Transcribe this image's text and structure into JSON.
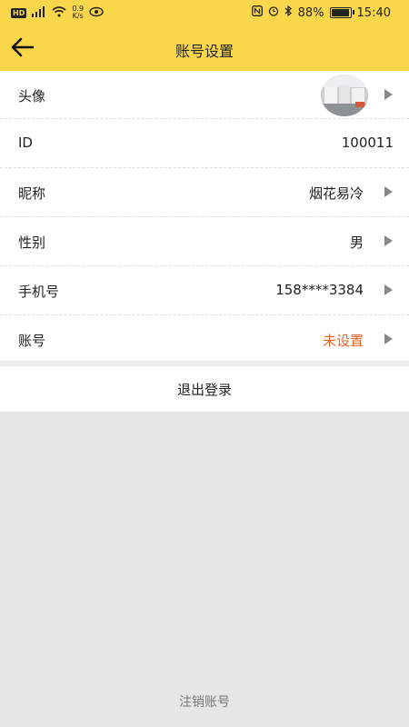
{
  "status_bar": {
    "network": "HD",
    "signal": "4G",
    "speed_value": "0.9",
    "speed_unit": "K/s",
    "battery": "88%",
    "battery_level": 0.88,
    "time": "15:40",
    "icons": [
      "nfc-icon",
      "alarm-icon",
      "bluetooth-icon",
      "eye-icon",
      "wifi-icon"
    ]
  },
  "header": {
    "title": "账号设置",
    "back_icon": "arrow-left-icon"
  },
  "rows": {
    "avatar": {
      "label": "头像"
    },
    "id": {
      "label": "ID",
      "value": "100011"
    },
    "nickname": {
      "label": "昵称",
      "value": "烟花易冷"
    },
    "gender": {
      "label": "性别",
      "value": "男"
    },
    "phone": {
      "label": "手机号",
      "value": "158****3384"
    },
    "account": {
      "label": "账号",
      "value": "未设置"
    }
  },
  "logout_label": "退出登录",
  "cancel_account_label": "注销账号",
  "colors": {
    "header_bg": "#fad64a",
    "page_bg": "#e6e6e6",
    "warn": "#e0652a"
  }
}
